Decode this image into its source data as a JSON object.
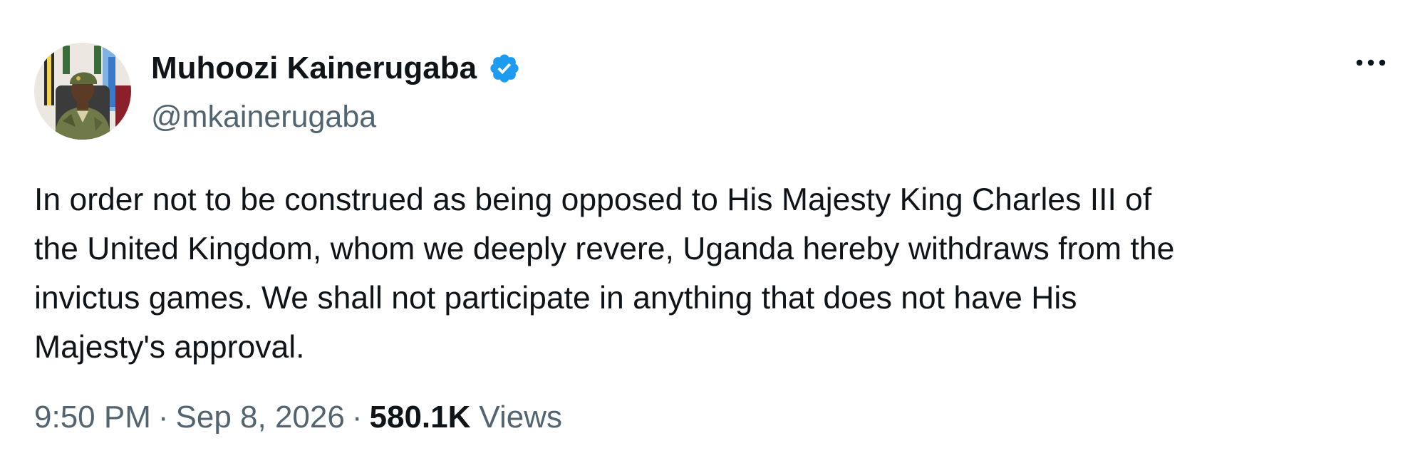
{
  "author": {
    "name": "Muhoozi Kainerugaba",
    "handle": "@mkainerugaba",
    "verified": true,
    "verified_icon": "verified-badge-icon",
    "verified_color": "#1d9bf0",
    "avatar_icon": "profile-photo"
  },
  "menu": {
    "icon": "more-options-icon",
    "label": "···"
  },
  "tweet": {
    "text": "In order not to be construed as being opposed to His Majesty King Charles III of\nthe United Kingdom, whom we deeply revere, Uganda hereby withdraws from the\ninvictus games. We shall not participate in anything that does not have His\nMajesty's approval."
  },
  "meta": {
    "time": "9:50 PM",
    "separator": "·",
    "date": "Sep 8, 2026",
    "views_count": "580.1K",
    "views_label": "Views"
  },
  "colors": {
    "text_primary": "#0f1419",
    "text_secondary": "#536471",
    "accent": "#1d9bf0"
  }
}
